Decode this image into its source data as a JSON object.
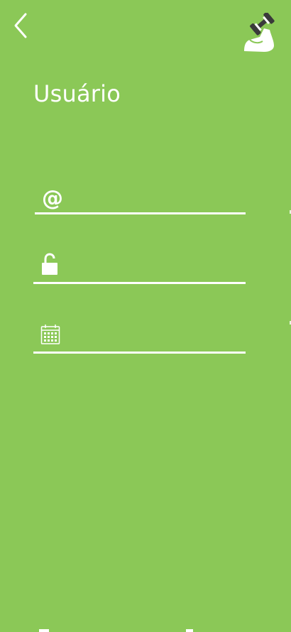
{
  "header": {
    "title": "Usuário",
    "back_icon": "chevron-left-icon",
    "logo_icon": "flexed-arm-dumbbell-icon"
  },
  "form": {
    "email": {
      "value": "",
      "placeholder": "",
      "icon": "at-sign-icon",
      "glyph": "@"
    },
    "password": {
      "value": "",
      "placeholder": "",
      "icon": "unlocked-padlock-icon"
    },
    "birthdate": {
      "value": "",
      "placeholder": "",
      "icon": "calendar-icon"
    }
  },
  "colors": {
    "background": "#8bc857",
    "foreground": "#ffffff",
    "logo_dark": "#3a3a3a"
  }
}
